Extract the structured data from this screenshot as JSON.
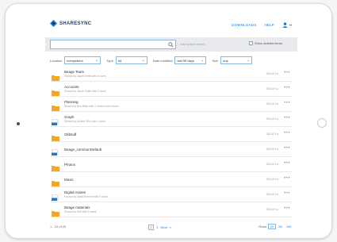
{
  "header": {
    "logo_text": "SHARESYNC",
    "nav": {
      "downloads": "DOWNLOADS",
      "help": "HELP"
    }
  },
  "search": {
    "value": "",
    "placeholder": "",
    "advanced_label": "Add search terms",
    "show_deleted_label": "Show deleted items"
  },
  "filters": {
    "location": {
      "label": "Location",
      "value": "everywhere"
    },
    "type": {
      "label": "Type",
      "value": "All"
    },
    "date_modified": {
      "label": "Date modified",
      "value": "last 90 days"
    },
    "size": {
      "label": "Size",
      "value": "any"
    }
  },
  "items": [
    {
      "name": "Beage Team",
      "sub": "Shared by Jacob Smith with 4 users",
      "size": "302,8 Ko",
      "shared": false
    },
    {
      "name": "Accounts",
      "sub": "Shared by Jacob Smith with 2 users",
      "size": "302,8 Ko",
      "shared": false
    },
    {
      "name": "Planning",
      "sub": "Shared by Bob Miller with 2 others and 5 users",
      "size": "302,8 Ko",
      "shared": false
    },
    {
      "name": "Graph",
      "sub": "Shared by Antoine Rev with 4 users",
      "size": "302,8 Ko",
      "shared": true
    },
    {
      "name": "Oldstuff",
      "sub": "",
      "size": "302,8 Ko",
      "shared": false
    },
    {
      "name": "Beage_commonDefault",
      "sub": "",
      "size": "302,8 Ko",
      "shared": true
    },
    {
      "name": "Photos",
      "sub": "",
      "size": "302,8 Ko",
      "shared": false
    },
    {
      "name": "Music",
      "sub": "",
      "size": "302,8 Ko",
      "shared": false
    },
    {
      "name": "Digital Assets",
      "sub": "Shared by David Bennett with 5 users",
      "size": "302,8 Ko",
      "shared": true
    },
    {
      "name": "Beage materials",
      "sub": "Shared by Bob with 3 users",
      "size": "302,8 Ko",
      "shared": false
    }
  ],
  "footer": {
    "count": "1 - 10 of 20",
    "pages": [
      "1",
      "2"
    ],
    "next": "Next",
    "rows_label": "Rows",
    "row_options": [
      "20",
      "50",
      "100"
    ]
  },
  "colors": {
    "accent": "#1a7ac9",
    "folder": "#f5a623",
    "brand": "#1f3a5f"
  }
}
